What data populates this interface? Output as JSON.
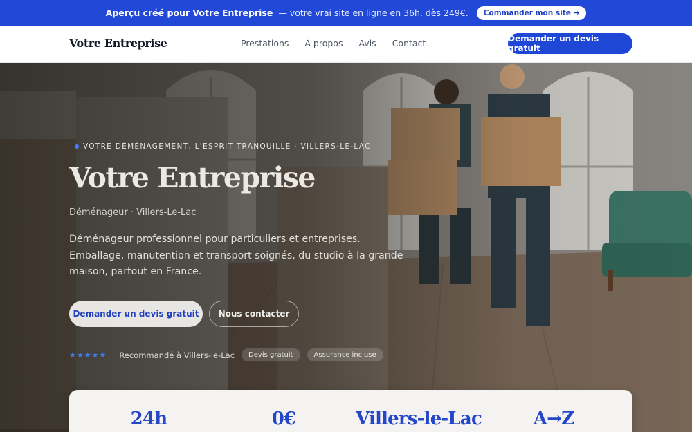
{
  "banner": {
    "bold": "Aperçu créé pour Votre Entreprise",
    "rest": "— votre vrai site en ligne en 36h, dès 249€.",
    "cta": "Commander mon site →"
  },
  "nav": {
    "brand": "Votre Entreprise",
    "links": [
      "Prestations",
      "À propos",
      "Avis",
      "Contact"
    ],
    "cta": "Demander un devis gratuit"
  },
  "hero": {
    "eyebrow": "VOTRE DÉMÉNAGEMENT, L'ESPRIT TRANQUILLE · VILLERS-LE-LAC",
    "title": "Votre Entreprise",
    "subtitle": "Déménageur · Villers-Le-Lac",
    "description": "Déménageur professionnel pour particuliers et entreprises. Emballage, manutention et transport soignés, du studio à la grande maison, partout en France.",
    "primary_cta": "Demander un devis gratuit",
    "secondary_cta": "Nous contacter",
    "stars": "★★★★★",
    "recommended": "Recommandé à Villers-le-Lac",
    "badges": [
      "Devis gratuit",
      "Assurance incluse"
    ],
    "image": "movers-carrying-boxes-photo"
  },
  "stats": [
    "24h",
    "0€",
    "Villers-le-Lac",
    "A→Z"
  ],
  "colors": {
    "brand_blue": "#1f47d6",
    "banner_blue": "#2148d6",
    "stat_blue": "#2447c9",
    "star_blue": "#3f7fe6"
  }
}
